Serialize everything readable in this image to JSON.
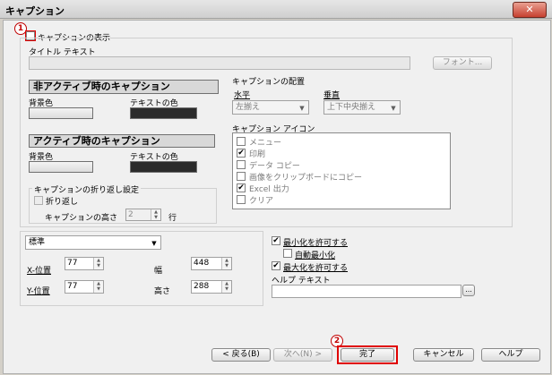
{
  "window": {
    "title": "キャプション",
    "close_glyph": "✕"
  },
  "caption_display": {
    "label": "キャプションの表示",
    "checked": false
  },
  "title_text": {
    "label": "タイトル テキスト",
    "value": "",
    "font_button": "フォント..."
  },
  "inactive_caption": {
    "header": "非アクティブ時のキャプション",
    "bg_label": "背景色",
    "text_color_label": "テキストの色"
  },
  "active_caption": {
    "header": "アクティブ時のキャプション",
    "bg_label": "背景色",
    "text_color_label": "テキストの色"
  },
  "wrap_settings": {
    "group_label": "キャプションの折り返し設定",
    "wrap_label": "折り返し",
    "height_label": "キャプションの高さ",
    "height_value": "2",
    "unit": "行"
  },
  "placement": {
    "group_label": "キャプションの配置",
    "horizontal_label": "水平",
    "horizontal_value": "左揃え",
    "vertical_label": "垂直",
    "vertical_value": "上下中央揃え"
  },
  "icons": {
    "group_label": "キャプション アイコン",
    "items": [
      {
        "label": "メニュー",
        "checked": false
      },
      {
        "label": "印刷",
        "checked": true
      },
      {
        "label": "データ コピー",
        "checked": false
      },
      {
        "label": "画像をクリップボードにコピー",
        "checked": false
      },
      {
        "label": "Excel 出力",
        "checked": true
      },
      {
        "label": "クリア",
        "checked": false
      }
    ]
  },
  "position": {
    "mode_value": "標準",
    "x_label": "X-位置",
    "x_value": "77",
    "y_label": "Y-位置",
    "y_value": "77",
    "width_label": "幅",
    "width_value": "448",
    "height_label": "高さ",
    "height_value": "288"
  },
  "window_options": {
    "minimize_label": "最小化を許可する",
    "minimize_checked": true,
    "auto_minimize_label": "自動最小化",
    "auto_minimize_checked": false,
    "maximize_label": "最大化を許可する",
    "maximize_checked": true,
    "help_text_label": "ヘルプ テキスト",
    "help_text_value": "",
    "browse_button": "..."
  },
  "footer": {
    "back": "< 戻る(B)",
    "next": "次へ(N) >",
    "finish": "完了",
    "cancel": "キャンセル",
    "help": "ヘルプ"
  },
  "markers": {
    "one": "1",
    "two": "2"
  },
  "colors": {
    "highlight_red": "#e00000"
  }
}
